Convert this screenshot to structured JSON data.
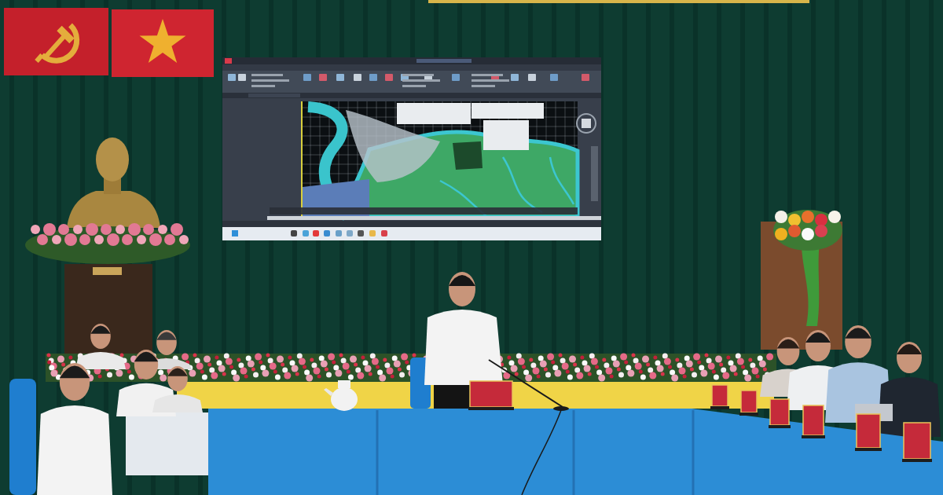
{
  "photo": {
    "flags": [
      {
        "kind": "sickle"
      },
      {
        "kind": "star"
      }
    ]
  }
}
